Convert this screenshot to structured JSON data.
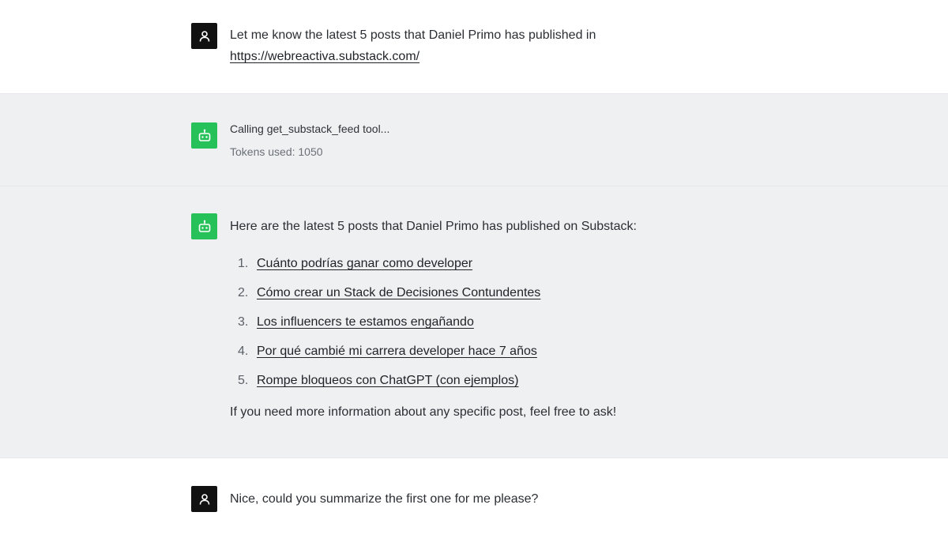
{
  "conversation": {
    "user_message_1": {
      "text": "Let me know the latest 5 posts that Daniel Primo has published in",
      "link": "https://webreactiva.substack.com/"
    },
    "tool_call": {
      "status": "Calling get_substack_feed tool...",
      "tokens": "Tokens used: 1050"
    },
    "assistant_answer": {
      "intro": "Here are the latest 5 posts that Daniel Primo has published on Substack:",
      "posts": [
        {
          "number": "1.",
          "title": "Cuánto podrías ganar como developer"
        },
        {
          "number": "2.",
          "title": "Cómo crear un Stack de Decisiones Contundentes"
        },
        {
          "number": "3.",
          "title": "Los influencers te estamos engañando"
        },
        {
          "number": "4.",
          "title": "Por qué cambié mi carrera developer hace 7 años"
        },
        {
          "number": "5.",
          "title": "Rompe bloqueos con ChatGPT (con ejemplos)"
        }
      ],
      "closing": "If you need more information about any specific post, feel free to ask!"
    },
    "user_message_2": {
      "text": "Nice, could you summarize the first one for me please?"
    }
  },
  "colors": {
    "user_avatar": "#111111",
    "bot_avatar": "#27c15a",
    "bot_background": "#eef0f2"
  },
  "icons": {
    "user": "user-icon",
    "bot": "robot-icon"
  }
}
